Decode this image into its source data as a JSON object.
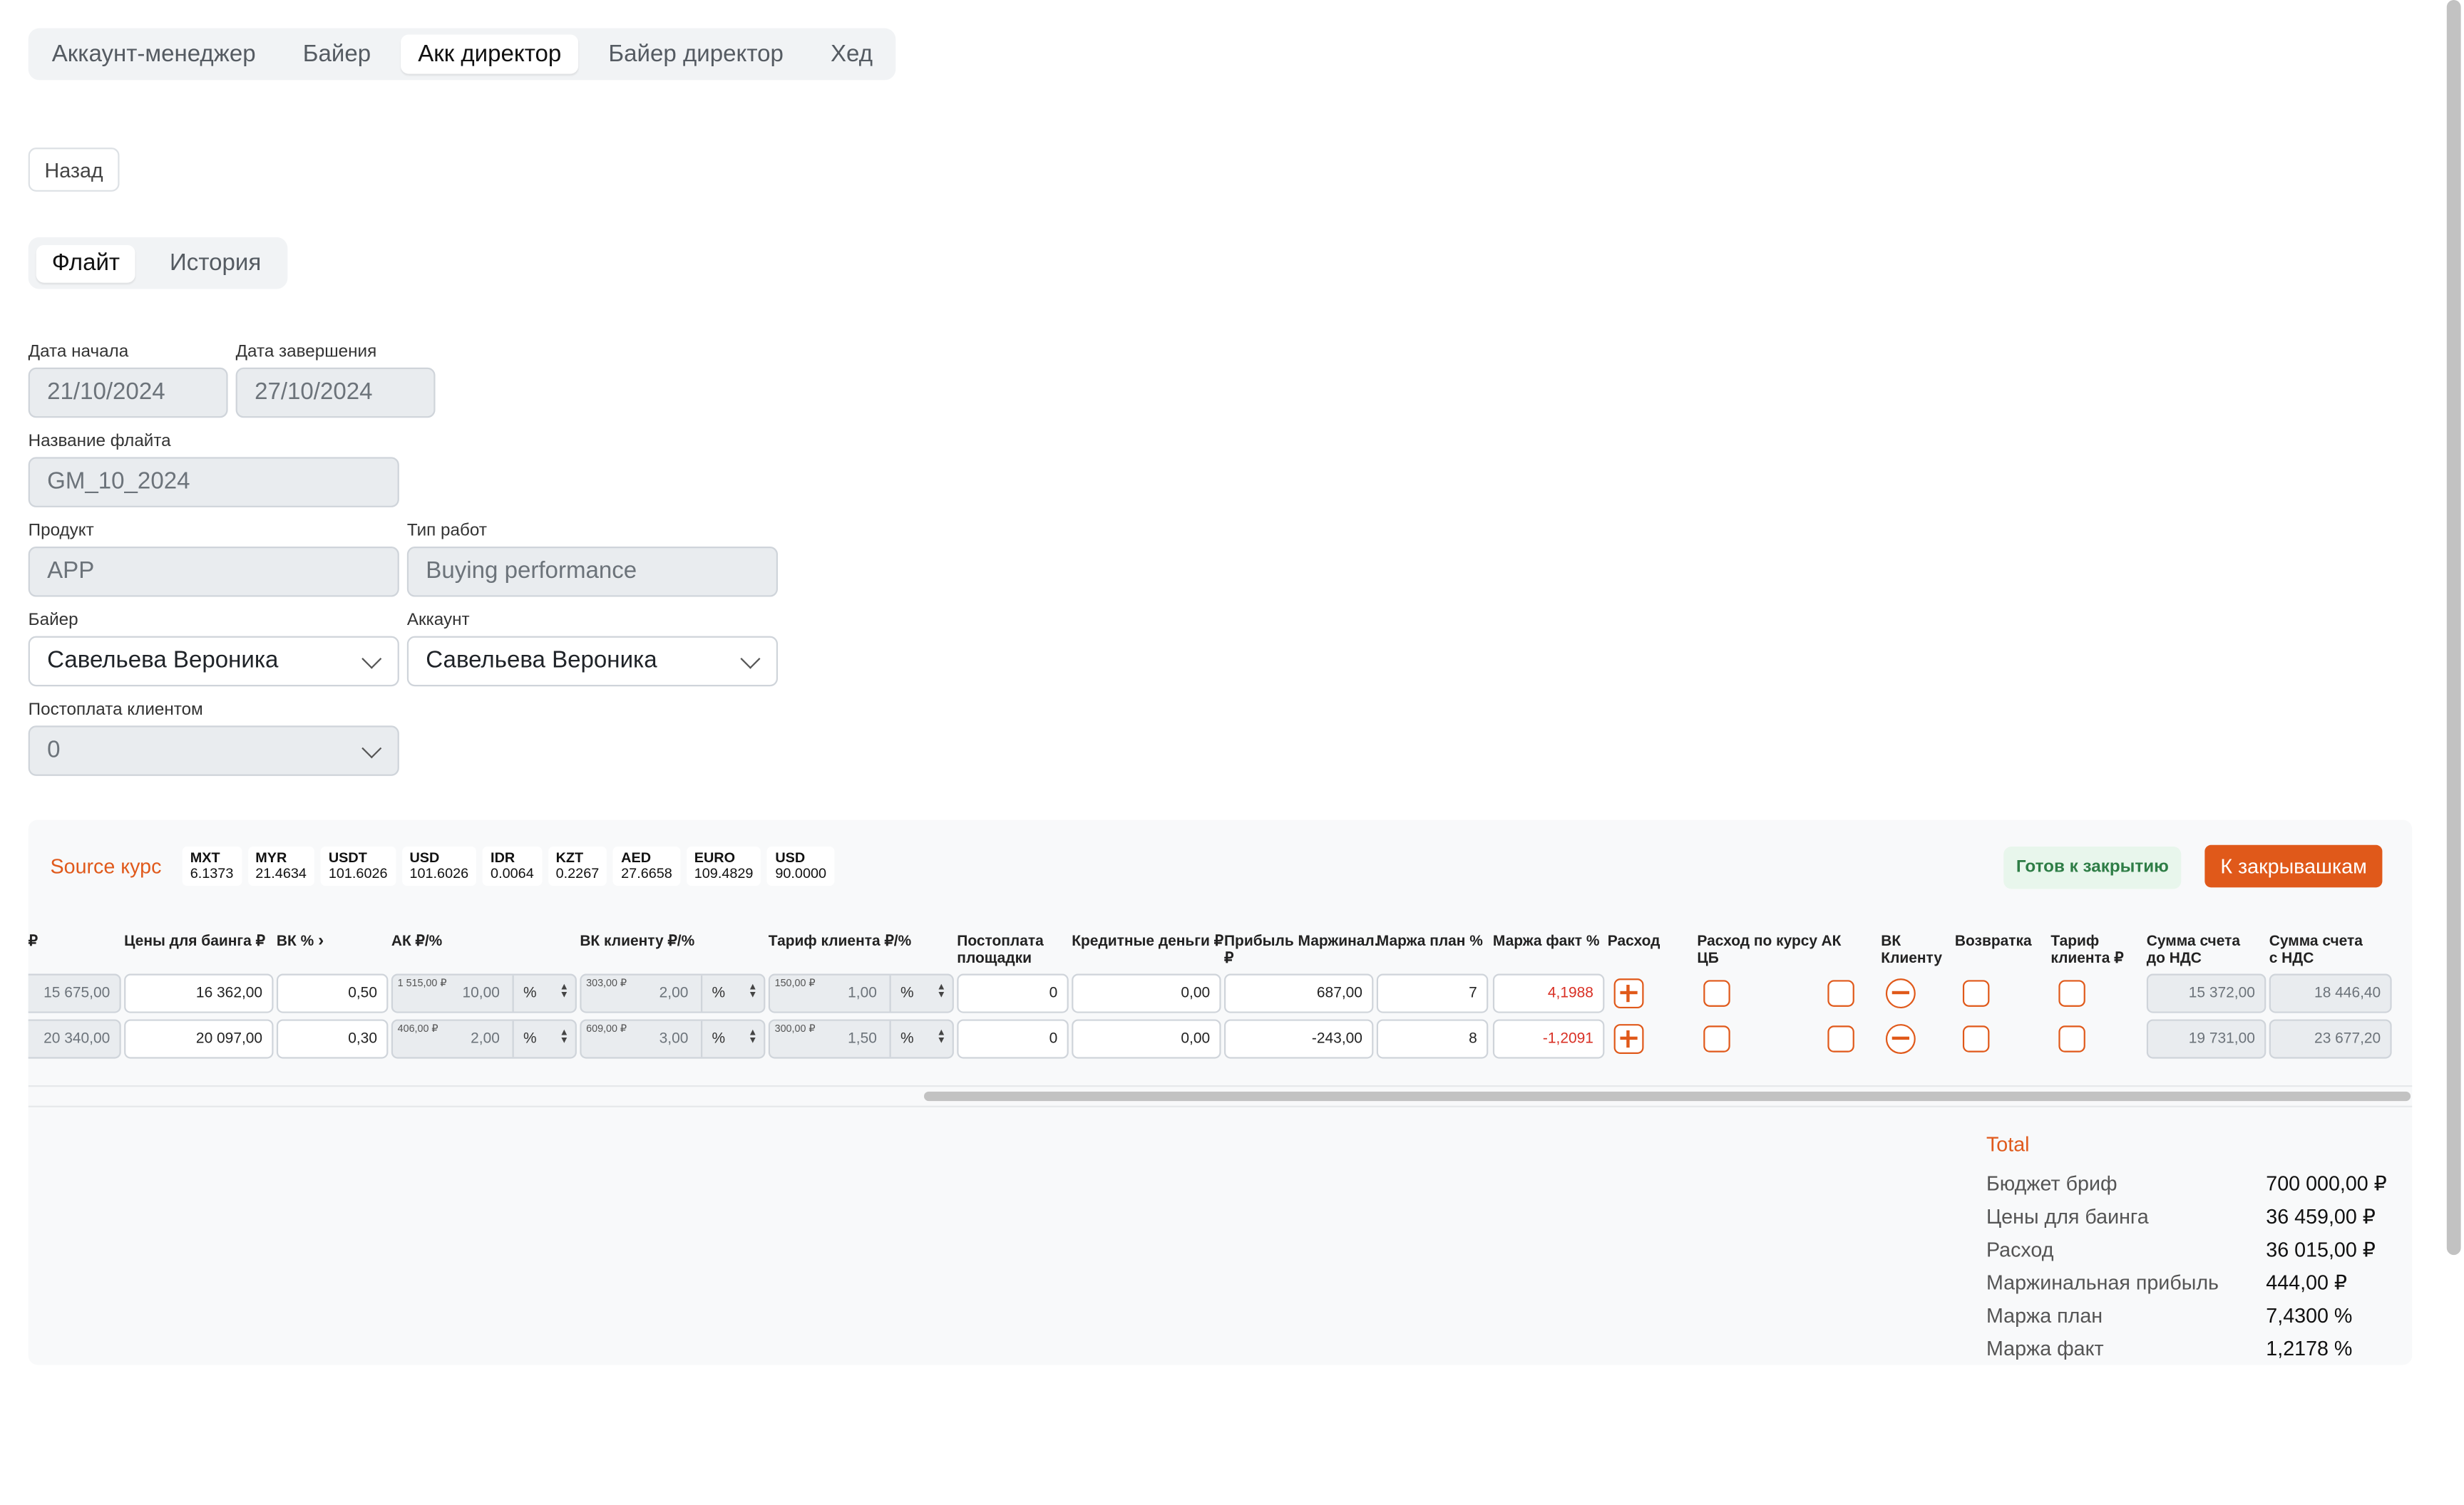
{
  "role_tabs": [
    "Аккаунт-менеджер",
    "Байер",
    "Акк директор",
    "Байер директор",
    "Хед"
  ],
  "active_role_tab": "Акк директор",
  "back_label": "Назад",
  "sub_tabs": [
    "Флайт",
    "История"
  ],
  "form": {
    "start_date_label": "Дата начала",
    "start_date": "21/10/2024",
    "end_date_label": "Дата завершения",
    "end_date": "27/10/2024",
    "flight_name_label": "Название флайта",
    "flight_name": "GM_10_2024",
    "product_label": "Продукт",
    "product": "APP",
    "work_type_label": "Тип работ",
    "work_type": "Buying performance",
    "buyer_label": "Байер",
    "buyer": "Савельева Вероника",
    "account_label": "Аккаунт",
    "account": "Савельева Вероника",
    "postpay_label": "Постоплата клиентом",
    "postpay": "0"
  },
  "rates_label": "Source курс",
  "rates": [
    {
      "code": "MXT",
      "value": "6.1373"
    },
    {
      "code": "MYR",
      "value": "21.4634"
    },
    {
      "code": "USDT",
      "value": "101.6026"
    },
    {
      "code": "USD",
      "value": "101.6026"
    },
    {
      "code": "IDR",
      "value": "0.0064"
    },
    {
      "code": "KZT",
      "value": "0.2267"
    },
    {
      "code": "AED",
      "value": "27.6658"
    },
    {
      "code": "EURO",
      "value": "109.4829"
    },
    {
      "code": "USD",
      "value": "90.0000"
    }
  ],
  "status_badge": "Готов к закрытию",
  "close_button": "К закрывашкам",
  "table": {
    "headers": {
      "cut": "₽",
      "buying_price": "Цены для баинга ₽",
      "vk_pct": "ВК %",
      "ak": "АК ₽/%",
      "vk_client": "ВК клиенту ₽/%",
      "tariff": "Тариф клиента ₽/%",
      "postpay_1": "Постоплата",
      "postpay_2": "площадки",
      "credit": "Кредитные деньги ₽",
      "profit_1": "Прибыль Маржинал.",
      "profit_2": "₽",
      "margin_plan": "Маржа план %",
      "margin_fact": "Маржа факт %",
      "expense": "Расход",
      "expense_cb_1": "Расход по курсу",
      "expense_cb_2": "ЦБ",
      "ak_flag": "АК",
      "vk_client_flag_1": "ВК",
      "vk_client_flag_2": "Клиенту",
      "refund": "Возвратка",
      "tariff_flag_1": "Тариф",
      "tariff_flag_2": "клиента ₽",
      "sum_pre_vat_1": "Сумма счета",
      "sum_pre_vat_2": "до НДС",
      "sum_vat_1": "Сумма счета",
      "sum_vat_2": "с НДС"
    },
    "unit": "%",
    "rows": [
      {
        "cut": "15 675,00",
        "buying_price": "16 362,00",
        "vk_pct": "0,50",
        "ak_rub": "1 515,00 ₽",
        "ak_pct": "10,00",
        "vk_client_rub": "303,00 ₽",
        "vk_client_pct": "2,00",
        "tariff_rub": "150,00 ₽",
        "tariff_pct": "1,00",
        "postpay": "0",
        "credit": "0,00",
        "profit": "687,00",
        "margin_plan": "7",
        "margin_fact": "4,1988",
        "sum_pre_vat": "15 372,00",
        "sum_vat": "18 446,40"
      },
      {
        "cut": "20 340,00",
        "buying_price": "20 097,00",
        "vk_pct": "0,30",
        "ak_rub": "406,00 ₽",
        "ak_pct": "2,00",
        "vk_client_rub": "609,00 ₽",
        "vk_client_pct": "3,00",
        "tariff_rub": "300,00 ₽",
        "tariff_pct": "1,50",
        "postpay": "0",
        "credit": "0,00",
        "profit": "-243,00",
        "margin_plan": "8",
        "margin_fact": "-1,2091",
        "sum_pre_vat": "19 731,00",
        "sum_vat": "23 677,20"
      }
    ]
  },
  "totals": {
    "title": "Total",
    "items": [
      {
        "label": "Бюджет бриф",
        "value": "700 000,00 ₽"
      },
      {
        "label": "Цены для баинга",
        "value": "36 459,00 ₽"
      },
      {
        "label": "Расход",
        "value": "36 015,00 ₽"
      },
      {
        "label": "Маржинальная прибыль",
        "value": "444,00 ₽"
      },
      {
        "label": "Маржа план",
        "value": "7,4300 %"
      },
      {
        "label": "Маржа факт",
        "value": "1,2178 %"
      }
    ]
  },
  "colors": {
    "accent": "#e0591a",
    "negative": "#d93025",
    "ready_bg": "#e8f6ec",
    "ready_text": "#2e7d46"
  }
}
